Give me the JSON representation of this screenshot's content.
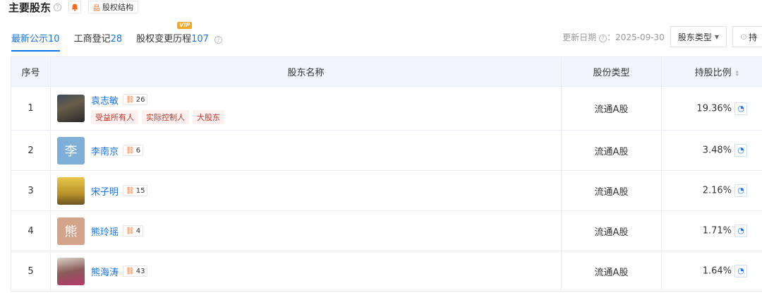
{
  "header": {
    "title": "主要股东",
    "equity_button": "股权结构"
  },
  "tabs": [
    {
      "label": "最新公示",
      "count": "10"
    },
    {
      "label": "工商登记",
      "count": "28"
    },
    {
      "label": "股权变更历程",
      "count": "107",
      "badge": "VIP"
    }
  ],
  "toolbar": {
    "update_label": "更新日期",
    "update_date": "：2025-09-30",
    "type_filter": "股东类型",
    "hold_filter": "持"
  },
  "table": {
    "columns": [
      "序号",
      "股东名称",
      "股份类型",
      "持股比例"
    ],
    "rows": [
      {
        "index": "1",
        "name": "袁志敏",
        "relations": "26",
        "avatar_text": "",
        "tags": [
          "受益所有人",
          "实际控制人",
          "大股东"
        ],
        "share_type": "流通A股",
        "ratio": "19.36%"
      },
      {
        "index": "2",
        "name": "李南京",
        "relations": "6",
        "avatar_text": "李",
        "tags": [],
        "share_type": "流通A股",
        "ratio": "3.48%"
      },
      {
        "index": "3",
        "name": "宋子明",
        "relations": "15",
        "avatar_text": "",
        "tags": [],
        "share_type": "流通A股",
        "ratio": "2.16%"
      },
      {
        "index": "4",
        "name": "熊玲瑶",
        "relations": "4",
        "avatar_text": "熊",
        "tags": [],
        "share_type": "流通A股",
        "ratio": "1.71%"
      },
      {
        "index": "5",
        "name": "熊海涛",
        "relations": "43",
        "avatar_text": "",
        "tags": [],
        "share_type": "流通A股",
        "ratio": "1.64%"
      }
    ]
  },
  "colors": {
    "accent": "#1a73e8",
    "header_bg": "#f2f6fc",
    "tag_text": "#c0392b",
    "tag_bg": "#fdf0f0",
    "relation_icon": "#f26b1d"
  }
}
